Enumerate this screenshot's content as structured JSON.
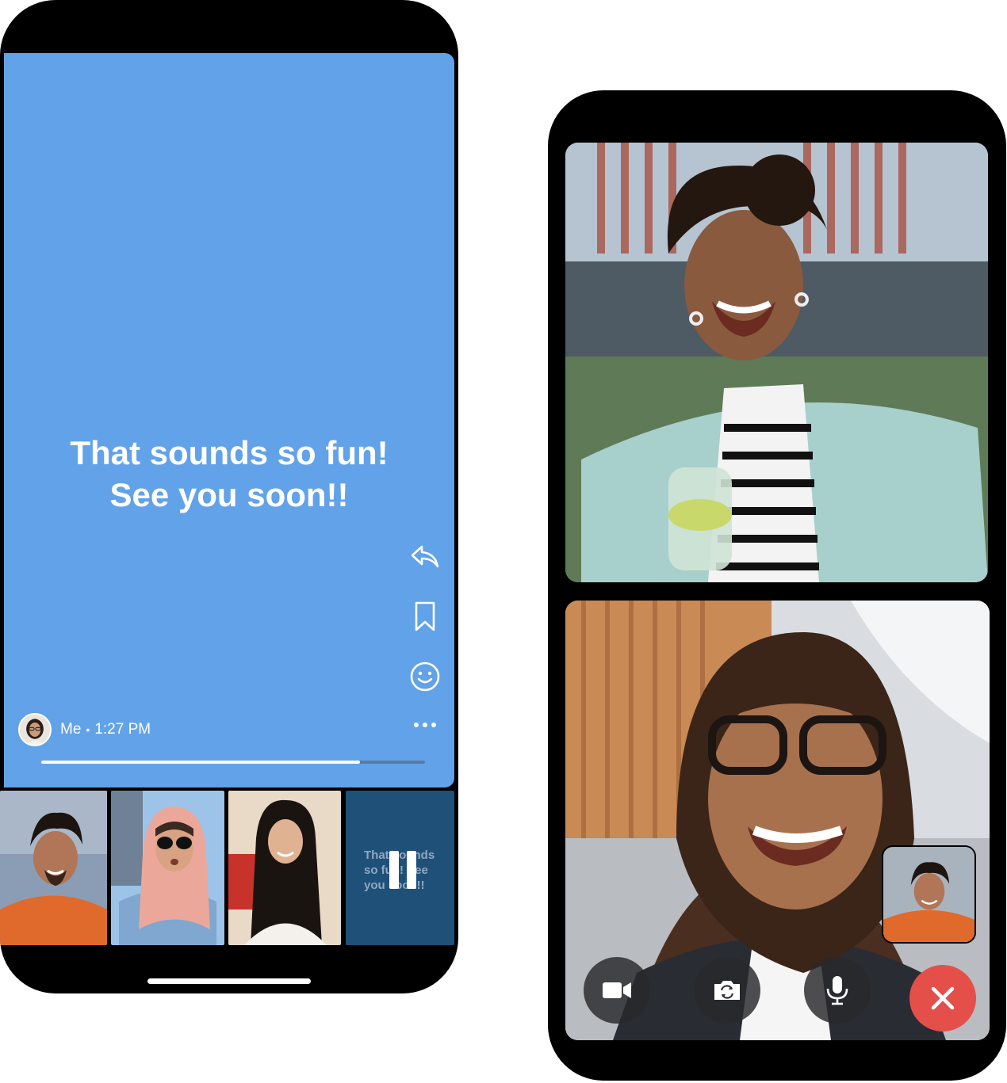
{
  "story": {
    "line1": "That sounds so fun!",
    "line2": "See you soon!!",
    "author": "Me",
    "separator": "•",
    "time": "1:27 PM",
    "progress": 0.83,
    "background_color": "#62a2e8",
    "actions": [
      "reply-icon",
      "bookmark-icon",
      "smiley-icon",
      "more-icon"
    ]
  },
  "thumbnails": {
    "preview_text": "That sounds so fun! See you soon!!",
    "paused": true
  },
  "call": {
    "controls": [
      "video-camera-icon",
      "switch-camera-icon",
      "microphone-icon",
      "end-call-icon"
    ],
    "end_color": "#e44f4a"
  }
}
